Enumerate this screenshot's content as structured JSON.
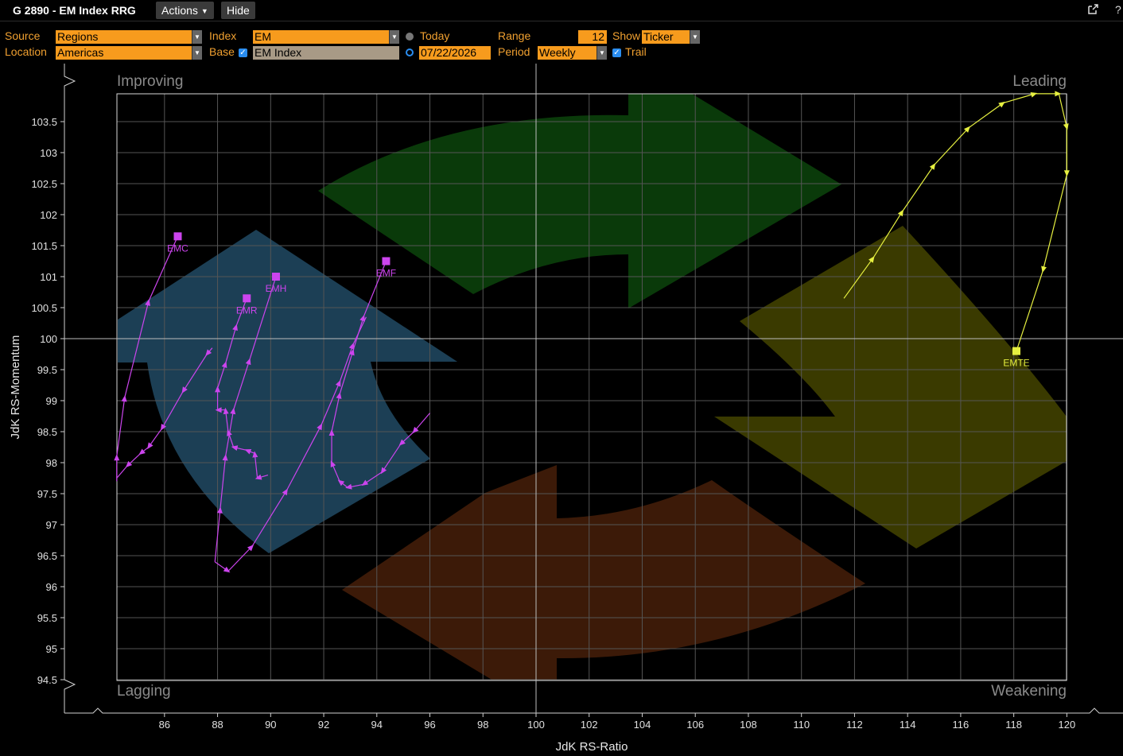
{
  "app": {
    "title": "G 2890 - EM Index RRG",
    "actions_label": "Actions",
    "hide_label": "Hide",
    "icons": [
      "export-icon",
      "help-icon"
    ],
    "help_glyph": "?"
  },
  "controls": {
    "source": {
      "label": "Source",
      "value": "Regions"
    },
    "location": {
      "label": "Location",
      "value": "Americas"
    },
    "index": {
      "label": "Index",
      "value": "EM"
    },
    "base": {
      "label": "Base",
      "checked": true,
      "value": "EM Index"
    },
    "today": {
      "label": "Today",
      "selected": false
    },
    "date": {
      "value": "07/22/2026",
      "selected": true
    },
    "range": {
      "label": "Range",
      "value": "12"
    },
    "period": {
      "label": "Period",
      "value": "Weekly"
    },
    "show": {
      "label": "Show",
      "value": "Ticker"
    },
    "trail": {
      "label": "Trail",
      "checked": true
    }
  },
  "colors": {
    "accent_orange": "#f79b1d",
    "field_gray": "#a89a86",
    "improving": "#1c3f55",
    "leading": "#0a3a0a",
    "weakening": "#3a3a00",
    "lagging": "#3c1a08",
    "magenta_trail": "#cc44ee",
    "yellow_trail": "#e6f040"
  },
  "chart_data": {
    "type": "scatter",
    "xlabel": "JdK RS-Ratio",
    "ylabel": "JdK RS-Momentum",
    "xlim": [
      84.2,
      120
    ],
    "ylim": [
      94.4,
      103.9
    ],
    "xticks": [
      86,
      88,
      90,
      92,
      94,
      96,
      98,
      100,
      102,
      104,
      106,
      108,
      110,
      112,
      114,
      116,
      118,
      120
    ],
    "yticks": [
      94.5,
      95,
      95.5,
      96,
      96.5,
      97,
      97.5,
      98,
      98.5,
      99,
      99.5,
      100,
      100.5,
      101,
      101.5,
      102,
      102.5,
      103,
      103.5
    ],
    "grid": true,
    "center": [
      100,
      100
    ],
    "quadrants": {
      "top_left": "Improving",
      "top_right": "Leading",
      "bottom_left": "Lagging",
      "bottom_right": "Weakening"
    },
    "series": [
      {
        "name": "EMC",
        "color": "#cc44ee",
        "points": [
          [
            84.2,
            97.7
          ],
          [
            84.2,
            98.1
          ],
          [
            84.5,
            99.05
          ],
          [
            85.4,
            100.6
          ],
          [
            86.5,
            101.65
          ]
        ]
      },
      {
        "name": "EMR",
        "color": "#cc44ee",
        "points": [
          [
            87.8,
            99.85
          ],
          [
            87.6,
            99.75
          ],
          [
            86.7,
            99.15
          ],
          [
            85.9,
            98.55
          ],
          [
            85.4,
            98.25
          ],
          [
            85.1,
            98.15
          ],
          [
            84.6,
            97.95
          ],
          [
            84.2,
            97.75
          ]
        ]
      },
      {
        "name": "EMH",
        "color": "#cc44ee",
        "points": [
          [
            89.9,
            97.8
          ],
          [
            89.5,
            97.75
          ],
          [
            89.4,
            98.15
          ],
          [
            89.1,
            98.2
          ],
          [
            88.6,
            98.25
          ],
          [
            88.4,
            98.5
          ],
          [
            88.3,
            98.85
          ],
          [
            88.0,
            98.85
          ],
          [
            88.0,
            99.2
          ],
          [
            88.3,
            99.6
          ],
          [
            88.7,
            100.2
          ],
          [
            89.1,
            100.65
          ]
        ]
      },
      {
        "name": "EMF",
        "color": "#cc44ee",
        "points": [
          [
            96.0,
            98.8
          ],
          [
            95.4,
            98.5
          ],
          [
            94.9,
            98.3
          ],
          [
            94.2,
            97.85
          ],
          [
            93.5,
            97.65
          ],
          [
            92.9,
            97.6
          ],
          [
            92.6,
            97.7
          ],
          [
            92.3,
            98.0
          ],
          [
            92.3,
            98.5
          ],
          [
            92.6,
            99.1
          ],
          [
            93.1,
            99.8
          ],
          [
            93.5,
            100.35
          ],
          [
            94.35,
            101.25
          ]
        ]
      },
      {
        "name": "EMH trail",
        "color": "#cc44ee",
        "points": [
          [
            87.9,
            96.4
          ],
          [
            88.4,
            96.25
          ],
          [
            89.3,
            96.65
          ],
          [
            90.6,
            97.55
          ],
          [
            91.9,
            98.6
          ],
          [
            92.6,
            99.3
          ],
          [
            93.1,
            99.9
          ],
          [
            93.6,
            100.35
          ]
        ]
      },
      {
        "name": "EMH head",
        "color": "#cc44ee",
        "points": [
          [
            87.9,
            96.4
          ],
          [
            88.1,
            97.25
          ],
          [
            88.3,
            98.1
          ],
          [
            88.6,
            98.85
          ],
          [
            89.2,
            99.65
          ],
          [
            90.2,
            101.0
          ]
        ]
      },
      {
        "name": "EMTE",
        "color": "#e6f040",
        "points": [
          [
            111.6,
            100.65
          ],
          [
            112.7,
            101.3
          ],
          [
            113.8,
            102.05
          ],
          [
            115.0,
            102.8
          ],
          [
            116.3,
            103.4
          ],
          [
            117.6,
            103.8
          ],
          [
            118.8,
            103.95
          ],
          [
            119.7,
            103.95
          ],
          [
            120.0,
            103.4
          ],
          [
            120.0,
            102.65
          ],
          [
            119.1,
            101.1
          ],
          [
            118.1,
            99.8
          ]
        ]
      }
    ],
    "labels": [
      {
        "text": "EMC",
        "x": 86.5,
        "y": 101.65
      },
      {
        "text": "EMR",
        "x": 89.1,
        "y": 100.65
      },
      {
        "text": "EMH",
        "x": 90.2,
        "y": 101.0
      },
      {
        "text": "EMF",
        "x": 94.35,
        "y": 101.25
      },
      {
        "text": "EMTE",
        "x": 118.1,
        "y": 99.8
      }
    ]
  }
}
